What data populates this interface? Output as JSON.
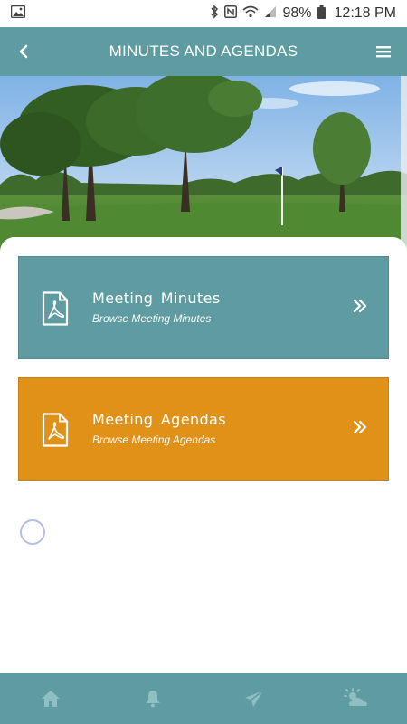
{
  "status_bar": {
    "battery": "98%",
    "time": "12:18 PM",
    "icons": [
      "image-icon",
      "bluetooth-icon",
      "nfc-icon",
      "wifi-icon",
      "signal-icon",
      "battery-icon"
    ]
  },
  "header": {
    "title": "MINUTES AND AGENDAS",
    "back_icon": "chevron-left-icon",
    "menu_icon": "hamburger-menu-icon"
  },
  "hero": {
    "description_icon": "golf-course-photo"
  },
  "cards": [
    {
      "title": "Meeting  Minutes",
      "subtitle": "Browse Meeting Minutes",
      "icon": "pdf-icon",
      "color": "#5e9ca1"
    },
    {
      "title": "Meeting  Agendas",
      "subtitle": "Browse Meeting Agendas",
      "icon": "pdf-icon",
      "color": "#e09118"
    }
  ],
  "bottom_nav": {
    "color": "#5e9ca1",
    "items": [
      "home-icon",
      "bell-icon",
      "send-icon",
      "weather-icon"
    ]
  }
}
